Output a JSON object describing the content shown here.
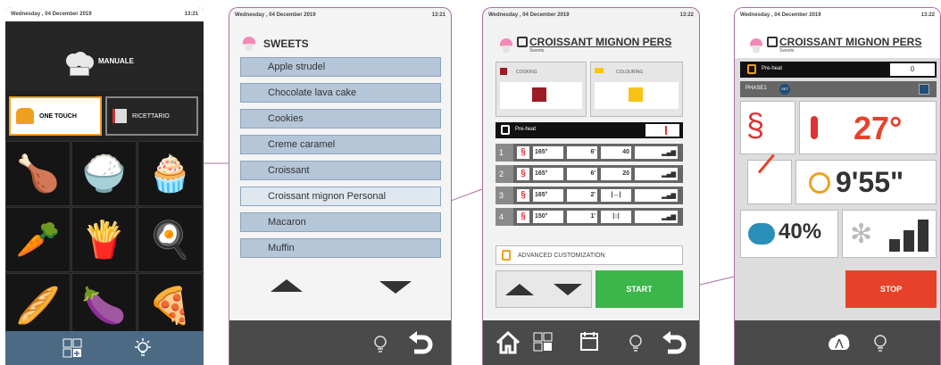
{
  "screen1": {
    "status_date": "Wednesday , 04 December 2019",
    "status_time": "13:21",
    "manuale_label": "MANUALE",
    "one_touch_label": "ONE TOUCH",
    "ricettario_label": "RICETTARIO",
    "grid_icons": [
      "roast-chicken-icon",
      "rice-bowl-icon",
      "cupcake-icon",
      "vegetables-icon",
      "french-fries-icon",
      "fried-eggs-icon",
      "breadsticks-icon",
      "grilled-vegetables-icon",
      "pizza-icon"
    ]
  },
  "screen2": {
    "status_date": "Wednesday , 04 December 2019",
    "status_time": "13:21",
    "title": "SWEETS",
    "items": [
      "Apple strudel",
      "Chocolate lava cake",
      "Cookies",
      "Creme caramel",
      "Croissant",
      "Croissant mignon Personal",
      "Macaron",
      "Muffin"
    ]
  },
  "screen3": {
    "status_date": "Wednesday , 04 December 2019",
    "status_time": "13:22",
    "title": "CROISSANT MIGNON PERS",
    "subtitle": "Sweets",
    "cooking_label": "COOKING",
    "colouring_label": "COLOURING",
    "preheat_label": "Pre-heat",
    "steps": [
      {
        "n": "1",
        "temp": "165°",
        "time": "6'",
        "hum": "40"
      },
      {
        "n": "2",
        "temp": "165°",
        "time": "6'",
        "hum": "20"
      },
      {
        "n": "3",
        "temp": "165°",
        "time": "2'",
        "hum": ""
      },
      {
        "n": "4",
        "temp": "150°",
        "time": "1'",
        "hum": ""
      }
    ],
    "advanced_label": "ADVANCED CUSTOMIZATION",
    "start_label": "START",
    "colors": {
      "cooking": "#9b1c24",
      "colouring": "#f9c315",
      "start": "#3cb54a"
    }
  },
  "screen4": {
    "status_date": "Wednesday , 04 December 2019",
    "status_time": "13:22",
    "title": "CROISSANT MIGNON PERS",
    "subtitle": "Sweets",
    "preheat_label": "Pre-heat",
    "preheat_value": "0",
    "phase_label": "PHASE1",
    "set_label": "SET",
    "temperature": "27°",
    "time": "9'55\"",
    "humidity": "40%",
    "stop_label": "STOP",
    "colors": {
      "temp": "#e8412a",
      "stop": "#e8412a"
    }
  }
}
